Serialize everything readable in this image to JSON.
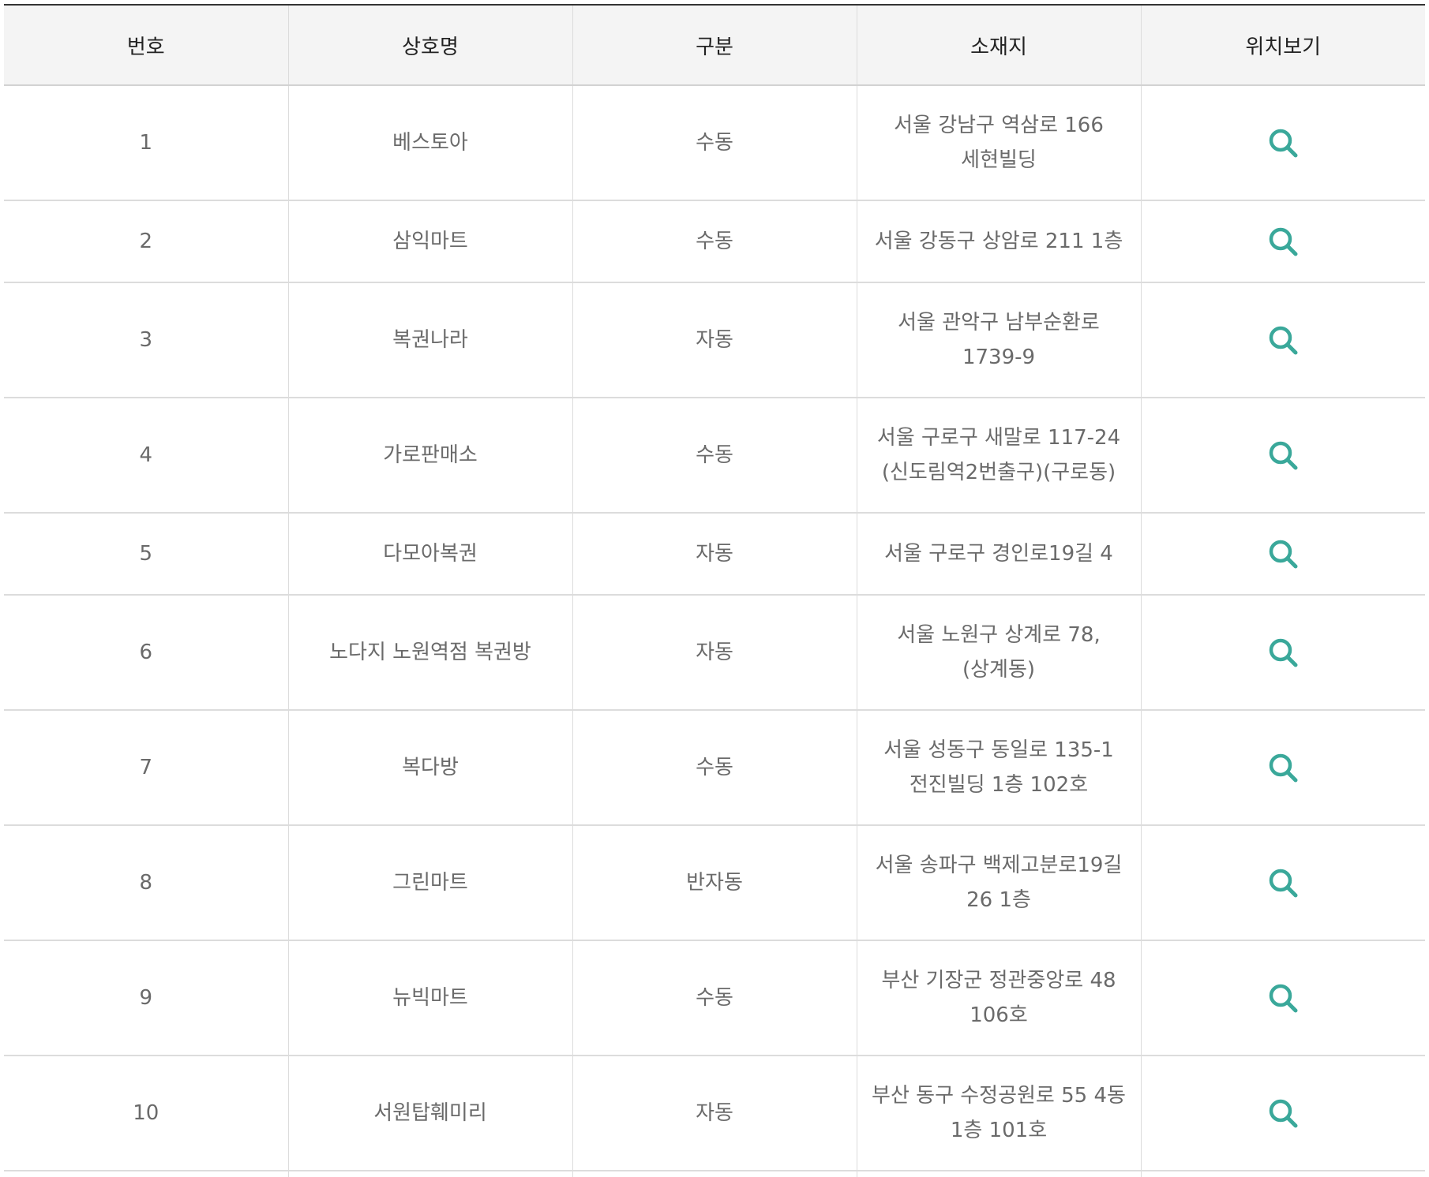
{
  "headers": {
    "number": "번호",
    "name": "상호명",
    "type": "구분",
    "address": "소재지",
    "location": "위치보기"
  },
  "rows": [
    {
      "number": "1",
      "name": "베스토아",
      "type": "수동",
      "address": "서울 강남구 역삼로 166 세현빌딩",
      "icon": "search-icon"
    },
    {
      "number": "2",
      "name": "삼익마트",
      "type": "수동",
      "address": "서울 강동구 상암로 211 1층",
      "icon": "search-icon"
    },
    {
      "number": "3",
      "name": "복권나라",
      "type": "자동",
      "address": "서울 관악구 남부순환로 1739-9",
      "icon": "search-icon"
    },
    {
      "number": "4",
      "name": "가로판매소",
      "type": "수동",
      "address": "서울 구로구 새말로 117-24 (신도림역2번출구)(구로동)",
      "icon": "search-icon"
    },
    {
      "number": "5",
      "name": "다모아복권",
      "type": "자동",
      "address": "서울 구로구 경인로19길 4",
      "icon": "search-icon"
    },
    {
      "number": "6",
      "name": "노다지 노원역점 복권방",
      "type": "자동",
      "address": "서울 노원구 상계로 78,(상계동)",
      "icon": "search-icon"
    },
    {
      "number": "7",
      "name": "복다방",
      "type": "수동",
      "address": "서울 성동구 동일로 135-1 전진빌딩 1층 102호",
      "icon": "search-icon"
    },
    {
      "number": "8",
      "name": "그린마트",
      "type": "반자동",
      "address": "서울 송파구 백제고분로19길 26 1층",
      "icon": "search-icon"
    },
    {
      "number": "9",
      "name": "뉴빅마트",
      "type": "수동",
      "address": "부산 기장군 정관중앙로 48 106호",
      "icon": "search-icon"
    },
    {
      "number": "10",
      "name": "서원탑훼미리",
      "type": "자동",
      "address": "부산 동구 수정공원로 55 4동 1층 101호",
      "icon": "search-icon"
    }
  ],
  "colors": {
    "icon_accent": "#3aa89a",
    "header_bg": "#f4f4f4",
    "top_rule": "#333333"
  }
}
